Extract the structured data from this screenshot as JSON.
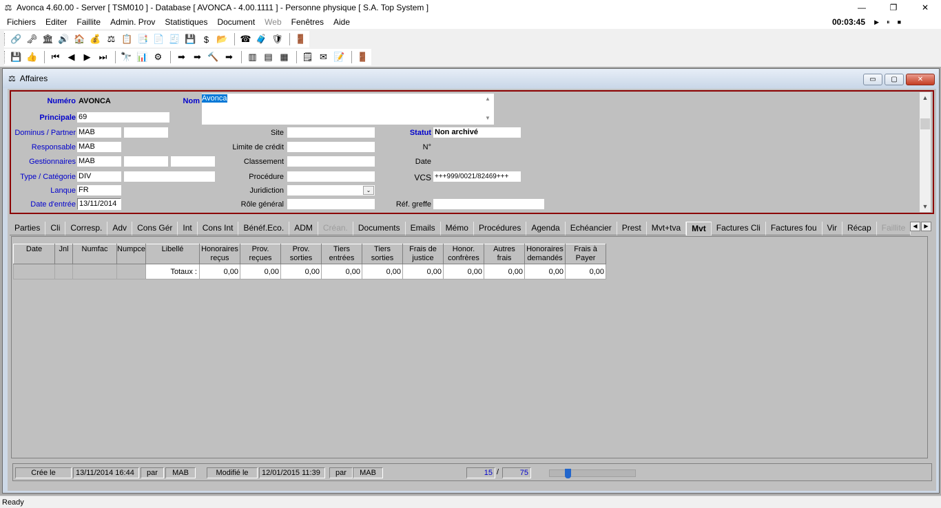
{
  "window": {
    "title": "Avonca 4.60.00 - Server [ TSM010 ] - Database [ AVONCA - 4.00.1111 ] - Personne physique [ S.A. Top System ]",
    "min": "—",
    "restore": "❐",
    "close": "✕"
  },
  "menu": {
    "items": [
      "Fichiers",
      "Editer",
      "Faillite",
      "Admin. Prov",
      "Statistiques",
      "Document",
      "Web",
      "Fenêtres",
      "Aide"
    ],
    "timer": "00:03:45",
    "play": "▶",
    "pause": "⏸",
    "stop": "■"
  },
  "toolbar1": [
    "🔗",
    "🗝",
    "🏛",
    "🔊",
    "🏠",
    "💰",
    "⚖",
    "📋",
    "📑",
    "📄",
    "🧾",
    "💾",
    "$",
    "📂",
    "☎",
    "🧳",
    "🛡",
    "🚪"
  ],
  "toolbar2": [
    "💾",
    "👍",
    "⏮",
    "◀",
    "▶",
    "⏭",
    "🔭",
    "📊",
    "⚙",
    "➡",
    "➡",
    "🔨",
    "➡",
    "▥",
    "▤",
    "▦",
    "🗒",
    "✉",
    "📝",
    "🚪"
  ],
  "child": {
    "title": "Affaires",
    "min": "▭",
    "max": "▢",
    "close": "✕"
  },
  "form": {
    "numero_label": "Numéro",
    "numero_value": "AVONCA",
    "nom_label": "Nom",
    "nom_value": "Avonca",
    "principale_label": "Principale",
    "principale_value": "69",
    "dominus_label": "Dominus / Partner",
    "dominus_value": "MAB",
    "responsable_label": "Responsable",
    "responsable_value": "MAB",
    "gestionnaires_label": "Gestionnaires",
    "gestionnaires_value": "MAB",
    "type_label": "Type / Catégorie",
    "type_value": "DIV",
    "langue_label": "Lanque",
    "langue_value": "FR",
    "date_entree_label": "Date d'entrée",
    "date_entree_value": "13/11/2014",
    "site_label": "Site",
    "limite_label": "Limite de crédit",
    "classement_label": "Classement",
    "procedure_label": "Procédure",
    "juridiction_label": "Juridiction",
    "role_label": "Rôle général",
    "statut_label": "Statut",
    "statut_value": "Non archivé",
    "no_label": "N°",
    "date_label": "Date",
    "vcs_label": "VCS",
    "vcs_value": "+++999/0021/82469+++",
    "ref_label": "Réf. greffe"
  },
  "tabs": [
    {
      "label": "Parties",
      "state": "normal"
    },
    {
      "label": "Cli",
      "state": "normal"
    },
    {
      "label": "Corresp.",
      "state": "normal"
    },
    {
      "label": "Adv",
      "state": "normal"
    },
    {
      "label": "Cons Gér",
      "state": "normal"
    },
    {
      "label": "Int",
      "state": "normal"
    },
    {
      "label": "Cons Int",
      "state": "normal"
    },
    {
      "label": "Bénéf.Eco.",
      "state": "normal"
    },
    {
      "label": "ADM",
      "state": "normal"
    },
    {
      "label": "Créan.",
      "state": "disabled"
    },
    {
      "label": "Documents",
      "state": "normal"
    },
    {
      "label": "Emails",
      "state": "normal"
    },
    {
      "label": "Mémo",
      "state": "normal"
    },
    {
      "label": "Procédures",
      "state": "normal"
    },
    {
      "label": "Agenda",
      "state": "normal"
    },
    {
      "label": "Echéancier",
      "state": "normal"
    },
    {
      "label": "Prest",
      "state": "normal"
    },
    {
      "label": "Mvt+tva",
      "state": "normal"
    },
    {
      "label": "Mvt",
      "state": "active"
    },
    {
      "label": "Factures Cli",
      "state": "normal"
    },
    {
      "label": "Factures fou",
      "state": "normal"
    },
    {
      "label": "Vir",
      "state": "normal"
    },
    {
      "label": "Récap",
      "state": "normal"
    },
    {
      "label": "Faillite",
      "state": "disabled"
    }
  ],
  "grid": {
    "columns": [
      {
        "l1": "Date",
        "l2": ""
      },
      {
        "l1": "Jnl",
        "l2": ""
      },
      {
        "l1": "Numfac",
        "l2": ""
      },
      {
        "l1": "Numpce",
        "l2": ""
      },
      {
        "l1": "Libellé",
        "l2": ""
      },
      {
        "l1": "Honoraires",
        "l2": "reçus"
      },
      {
        "l1": "Prov.",
        "l2": "reçues"
      },
      {
        "l1": "Prov.",
        "l2": "sorties"
      },
      {
        "l1": "Tiers",
        "l2": "entrées"
      },
      {
        "l1": "Tiers",
        "l2": "sorties"
      },
      {
        "l1": "Frais de",
        "l2": "justice"
      },
      {
        "l1": "Honor.",
        "l2": "confrères"
      },
      {
        "l1": "Autres",
        "l2": "frais"
      },
      {
        "l1": "Honoraires",
        "l2": "demandés"
      },
      {
        "l1": "Frais à",
        "l2": "Payer"
      }
    ],
    "totals_label": "Totaux :",
    "totals": [
      "0,00",
      "0,00",
      "0,00",
      "0,00",
      "0,00",
      "0,00",
      "0,00",
      "0,00",
      "0,00",
      "0,00"
    ]
  },
  "status_row": {
    "cree_label": "Crée le",
    "cree_value": "13/11/2014 16:44",
    "par1": "par",
    "user1": "MAB",
    "modifie_label": "Modifié le",
    "modifie_value": "12/01/2015 11:39",
    "par2": "par",
    "user2": "MAB",
    "current": "15",
    "sep": "/",
    "total": "75",
    "position_fraction": 0.19
  },
  "statusbar": "Ready"
}
